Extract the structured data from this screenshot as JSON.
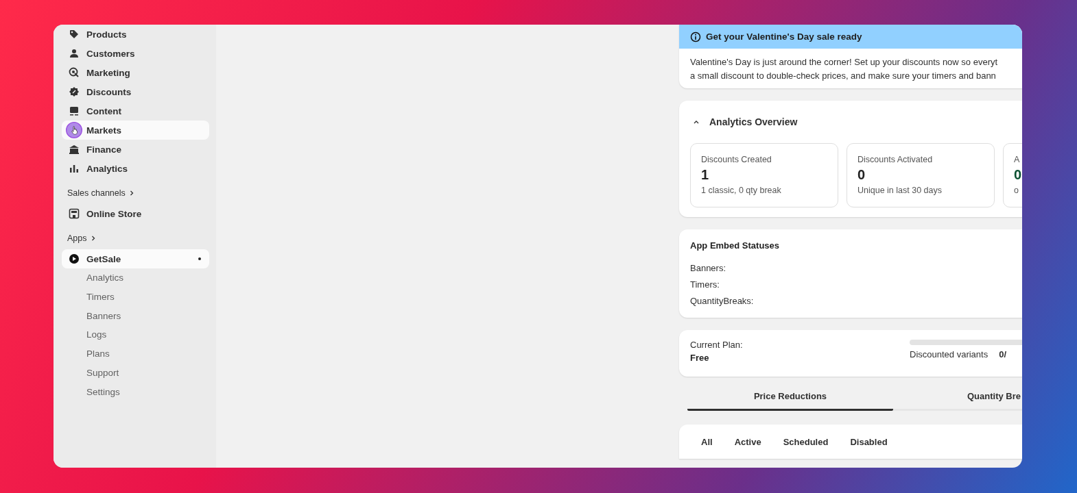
{
  "sidebar": {
    "items": [
      {
        "label": "Products",
        "selected": false
      },
      {
        "label": "Customers",
        "selected": false
      },
      {
        "label": "Marketing",
        "selected": false
      },
      {
        "label": "Discounts",
        "selected": false
      },
      {
        "label": "Content",
        "selected": false
      },
      {
        "label": "Markets",
        "selected": true
      },
      {
        "label": "Finance",
        "selected": false
      },
      {
        "label": "Analytics",
        "selected": false
      }
    ],
    "sales_channels": {
      "heading": "Sales channels",
      "items": [
        {
          "label": "Online Store",
          "selected": false
        }
      ]
    },
    "apps": {
      "heading": "Apps",
      "app": {
        "label": "GetSale",
        "selected": true,
        "children": [
          {
            "label": "Analytics"
          },
          {
            "label": "Timers"
          },
          {
            "label": "Banners"
          },
          {
            "label": "Logs"
          },
          {
            "label": "Plans"
          },
          {
            "label": "Support"
          },
          {
            "label": "Settings"
          }
        ]
      }
    }
  },
  "banner": {
    "title": "Get your Valentine's Day sale ready",
    "lines": [
      "Valentine's Day is just around the corner! Set up your discounts now so everyt",
      "a small discount to double-check prices, and make sure your timers and bann"
    ]
  },
  "analytics": {
    "title": "Analytics Overview",
    "expanded": true,
    "stats": [
      {
        "label": "Discounts Created",
        "value": "1",
        "note": "1 classic, 0 qty break"
      },
      {
        "label": "Discounts Activated",
        "value": "0",
        "note": "Unique in last 30 days"
      },
      {
        "label": "A",
        "value": "0",
        "note": "o"
      }
    ]
  },
  "embed_statuses": {
    "title": "App Embed Statuses",
    "rows": [
      "Banners:",
      "Timers:",
      "QuantityBreaks:"
    ]
  },
  "plan": {
    "label": "Current Plan:",
    "value": "Free",
    "usage_label": "Discounted variants",
    "usage_value": "0/",
    "level": 0
  },
  "tabs": [
    {
      "label": "Price Reductions",
      "selected": true
    },
    {
      "label": "Quantity Bre",
      "selected": false
    }
  ],
  "filters": [
    {
      "label": "All",
      "selected": false
    },
    {
      "label": "Active",
      "selected": false
    },
    {
      "label": "Scheduled",
      "selected": false
    },
    {
      "label": "Disabled",
      "selected": false
    }
  ]
}
